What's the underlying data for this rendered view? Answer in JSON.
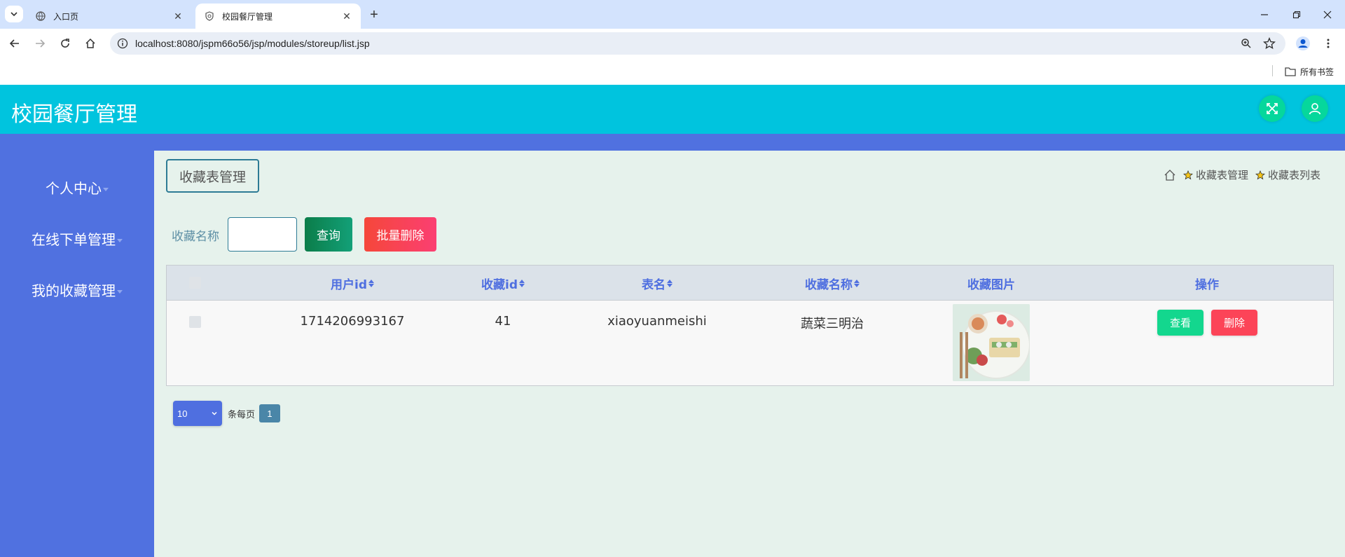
{
  "browser": {
    "tabs": [
      {
        "title": "入口页",
        "active": false
      },
      {
        "title": "校园餐厅管理",
        "active": true
      }
    ],
    "url": "localhost:8080/jspm66o56/jsp/modules/storeup/list.jsp",
    "bookmarks_folder": "所有书签"
  },
  "app": {
    "title": "校园餐厅管理",
    "colors": {
      "header": "#00c4de",
      "sidebar": "#5071e0",
      "accent": "#4f6fe0"
    }
  },
  "sidebar": {
    "items": [
      {
        "label": "个人中心"
      },
      {
        "label": "在线下单管理"
      },
      {
        "label": "我的收藏管理"
      }
    ]
  },
  "page": {
    "tag": "收藏表管理",
    "breadcrumbs": [
      "收藏表管理",
      "收藏表列表"
    ]
  },
  "search": {
    "label": "收藏名称",
    "value": "",
    "query_button": "查询",
    "batch_delete_button": "批量删除"
  },
  "table": {
    "columns": [
      "用户id",
      "收藏id",
      "表名",
      "收藏名称",
      "收藏图片",
      "操作"
    ],
    "rows": [
      {
        "user_id": "1714206993167",
        "fav_id": "41",
        "table_name": "xiaoyuanmeishi",
        "fav_name": "蔬菜三明治",
        "image": "food-photo"
      }
    ],
    "actions": {
      "view": "查看",
      "delete": "删除"
    }
  },
  "pagination": {
    "page_size": "10",
    "per_page_label": "条每页",
    "current_page": "1"
  }
}
